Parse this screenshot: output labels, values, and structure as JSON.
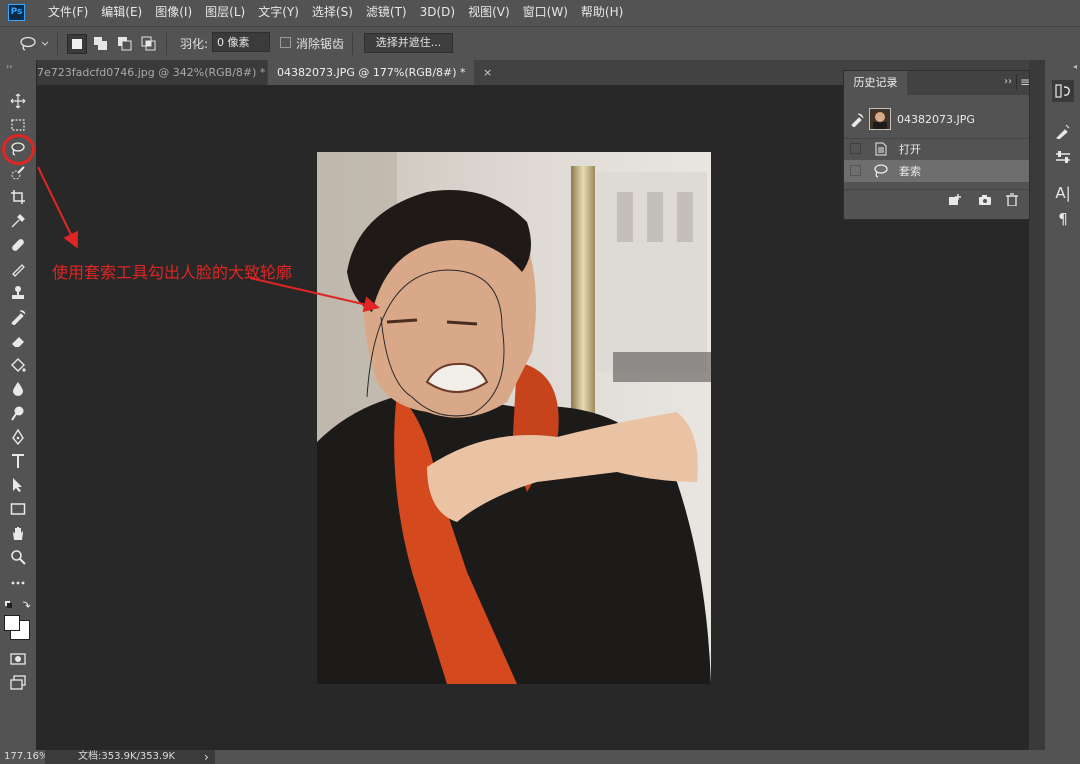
{
  "app": {
    "logo": "Ps"
  },
  "menu": [
    "文件(F)",
    "编辑(E)",
    "图像(I)",
    "图层(L)",
    "文字(Y)",
    "选择(S)",
    "滤镜(T)",
    "3D(D)",
    "视图(V)",
    "窗口(W)",
    "帮助(H)"
  ],
  "options": {
    "feather_label": "羽化:",
    "feather_value": "0 像素",
    "antialias_label": "消除锯齿",
    "select_and_mask": "选择并遮住..."
  },
  "tabs": [
    {
      "label": "7e723fadcfd0746.jpg @ 342%(RGB/8#) *",
      "close": "×",
      "active": false
    },
    {
      "label": "04382073.JPG @ 177%(RGB/8#) *",
      "close": "×",
      "active": true
    }
  ],
  "history": {
    "title": "历史记录",
    "menu_glyphs": {
      "collapse": "››",
      "menu": "≡"
    },
    "snapshot_name": "04382073.JPG",
    "items": [
      "打开",
      "套索"
    ]
  },
  "annotation": {
    "text": "使用套索工具勾出人脸的大致轮廓",
    "color": "#e02525"
  },
  "status": {
    "zoom": "177.16%",
    "doc": "文档:353.9K/353.9K",
    "arrow": "›"
  },
  "colors": {
    "accent": "#31a8ff",
    "annotation_red": "#e02525"
  }
}
